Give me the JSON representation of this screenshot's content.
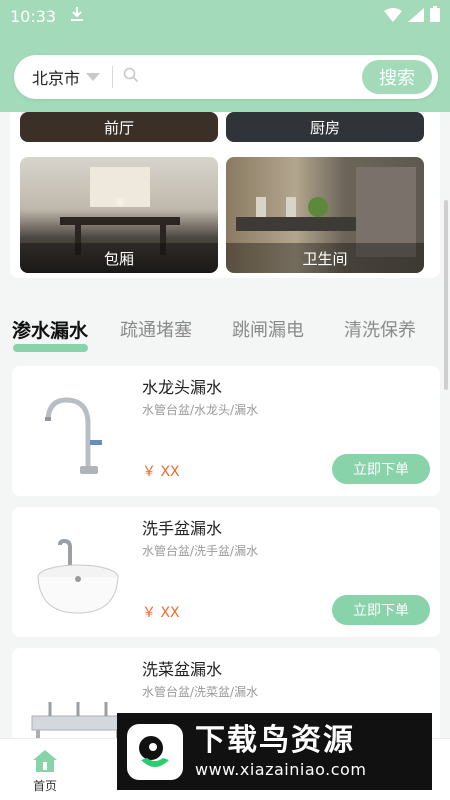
{
  "status": {
    "time": "10:33"
  },
  "search": {
    "city": "北京市",
    "button": "搜索",
    "placeholder": ""
  },
  "rooms": [
    {
      "label": "前厅"
    },
    {
      "label": "厨房"
    },
    {
      "label": "包厢"
    },
    {
      "label": "卫生间"
    }
  ],
  "tabs": [
    {
      "label": "渗水漏水"
    },
    {
      "label": "疏通堵塞"
    },
    {
      "label": "跳闸漏电"
    },
    {
      "label": "清洗保养"
    }
  ],
  "products": [
    {
      "title": "水龙头漏水",
      "subtitle": "水管台盆/水龙头/漏水",
      "price": "￥ XX",
      "button": "立即下单"
    },
    {
      "title": "洗手盆漏水",
      "subtitle": "水管台盆/洗手盆/漏水",
      "price": "￥ XX",
      "button": "立即下单"
    },
    {
      "title": "洗菜盆漏水",
      "subtitle": "水管台盆/洗菜盆/漏水",
      "price": "",
      "button": ""
    }
  ],
  "bottom_nav": [
    {
      "label": "首页"
    }
  ],
  "watermark": {
    "title": "下载鸟资源",
    "url": "www.xiazainiao.com"
  },
  "colors": {
    "brand": "#a3dab9",
    "accent": "#89d3ab",
    "price": "#f06a2a"
  }
}
